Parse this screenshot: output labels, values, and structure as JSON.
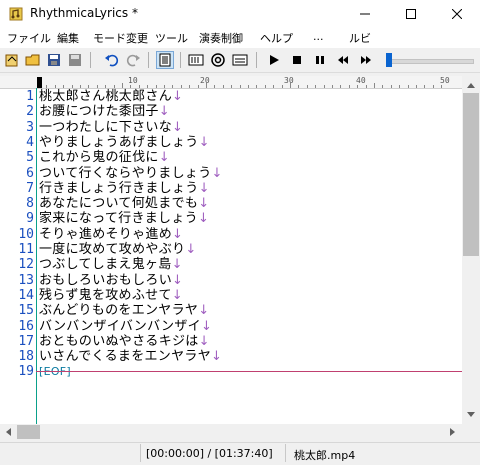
{
  "window": {
    "title": "RhythmicaLyrics *"
  },
  "menu": [
    "ファイル",
    "編集",
    "モード変更",
    "ツール",
    "演奏制御",
    "ヘルプ",
    "...",
    "ルビ"
  ],
  "ruler": {
    "marks": [
      "10",
      "20",
      "30",
      "40",
      "50"
    ]
  },
  "editor": {
    "lines": [
      {
        "num": "1",
        "text": "桃太郎さん桃太郎さん",
        "eol": "↓"
      },
      {
        "num": "2",
        "text": "お腰につけた黍団子",
        "eol": "↓"
      },
      {
        "num": "3",
        "text": "一つわたしに下さいな",
        "eol": "↓"
      },
      {
        "num": "4",
        "text": "やりましょうあげましょう",
        "eol": "↓"
      },
      {
        "num": "5",
        "text": "これから鬼の征伐に",
        "eol": "↓"
      },
      {
        "num": "6",
        "text": "ついて行くならやりましょう",
        "eol": "↓"
      },
      {
        "num": "7",
        "text": "行きましょう行きましょう",
        "eol": "↓"
      },
      {
        "num": "8",
        "text": "あなたについて何処までも",
        "eol": "↓"
      },
      {
        "num": "9",
        "text": "家来になって行きましょう",
        "eol": "↓"
      },
      {
        "num": "10",
        "text": "そりゃ進めそりゃ進め",
        "eol": "↓"
      },
      {
        "num": "11",
        "text": "一度に攻めて攻めやぶり",
        "eol": "↓"
      },
      {
        "num": "12",
        "text": "つぶしてしまえ鬼ヶ島",
        "eol": "↓"
      },
      {
        "num": "13",
        "text": "おもしろいおもしろい",
        "eol": "↓"
      },
      {
        "num": "14",
        "text": "残らず鬼を攻めふせて",
        "eol": "↓"
      },
      {
        "num": "15",
        "text": "ぶんどりものをエンヤラヤ",
        "eol": "↓"
      },
      {
        "num": "16",
        "text": "バンバンザイバンバンザイ",
        "eol": "↓"
      },
      {
        "num": "17",
        "text": "おとものいぬやさるキジは",
        "eol": "↓"
      },
      {
        "num": "18",
        "text": "いさんでくるまをエンヤラヤ",
        "eol": "↓"
      },
      {
        "num": "19",
        "text": "[EOF]",
        "eol": ""
      }
    ]
  },
  "status": {
    "time": "[00:00:00] / [01:37:40]",
    "file": "桃太郎.mp4"
  },
  "playback": {
    "volume_fraction": 0.0
  }
}
